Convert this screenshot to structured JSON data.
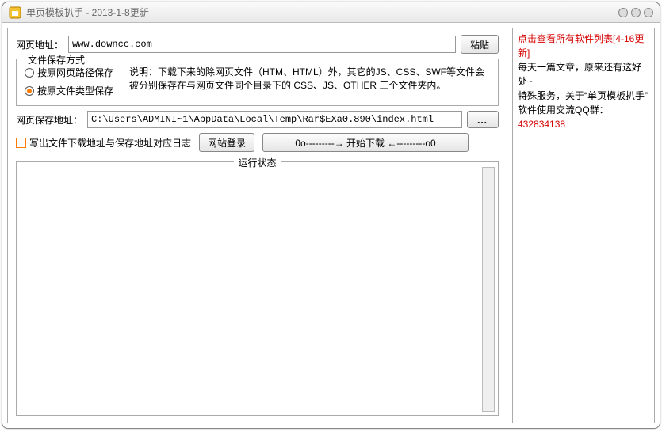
{
  "title": "单页模板扒手 - 2013-1-8更新",
  "url_row": {
    "label": "网页地址：",
    "value": "www.downcc.com",
    "paste_btn": "粘贴"
  },
  "save_method": {
    "legend": "文件保存方式",
    "opt1": "按原网页路径保存",
    "opt2": "按原文件类型保存",
    "desc": "说明：下载下来的除网页文件（HTM、HTML）外，其它的JS、CSS、SWF等文件会被分别保存在与网页文件同个目录下的 CSS、JS、OTHER 三个文件夹内。"
  },
  "save_path_row": {
    "label": "网页保存地址：",
    "value": "C:\\Users\\ADMINI~1\\AppData\\Local\\Temp\\Rar$EXa0.890\\index.html",
    "browse": "…"
  },
  "log_checkbox": "写出文件下载地址与保存地址对应日志",
  "login_btn": "网站登录",
  "start_btn": "0o---------→ 开始下载 ←---------o0",
  "status_legend": "运行状态",
  "side": {
    "link": "点击查看所有软件列表[4-16更新]",
    "line1": "每天一篇文章，原来还有这好处~",
    "line2": "特殊服务，关于“单页模板扒手”",
    "qq_label": "软件使用交流QQ群：",
    "qq_num": "432834138"
  }
}
